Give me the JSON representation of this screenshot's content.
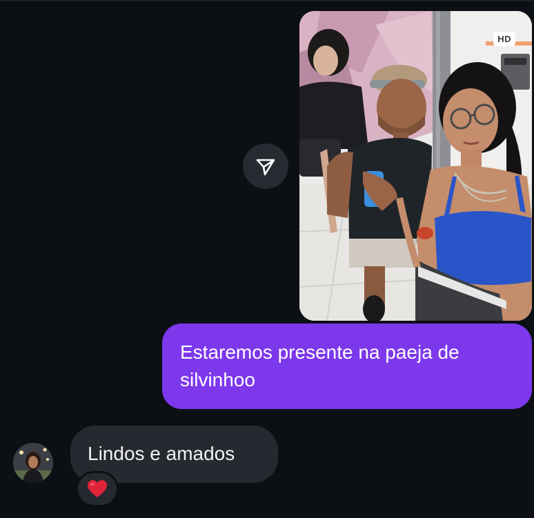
{
  "conversation": {
    "shared_photo": {
      "quality_badge": "HD",
      "share_icon": "send-paper-plane-icon"
    },
    "outgoing_message": {
      "text": "Estaremos presente na paeja de silvinhoo"
    },
    "incoming_message": {
      "text": "Lindos e amados",
      "reaction": "❤️"
    }
  },
  "colors": {
    "background": "#0c0f14",
    "outgoing_bubble": "#7d38eb",
    "incoming_bubble": "#262a30",
    "reaction_heart": "#e0243a"
  }
}
